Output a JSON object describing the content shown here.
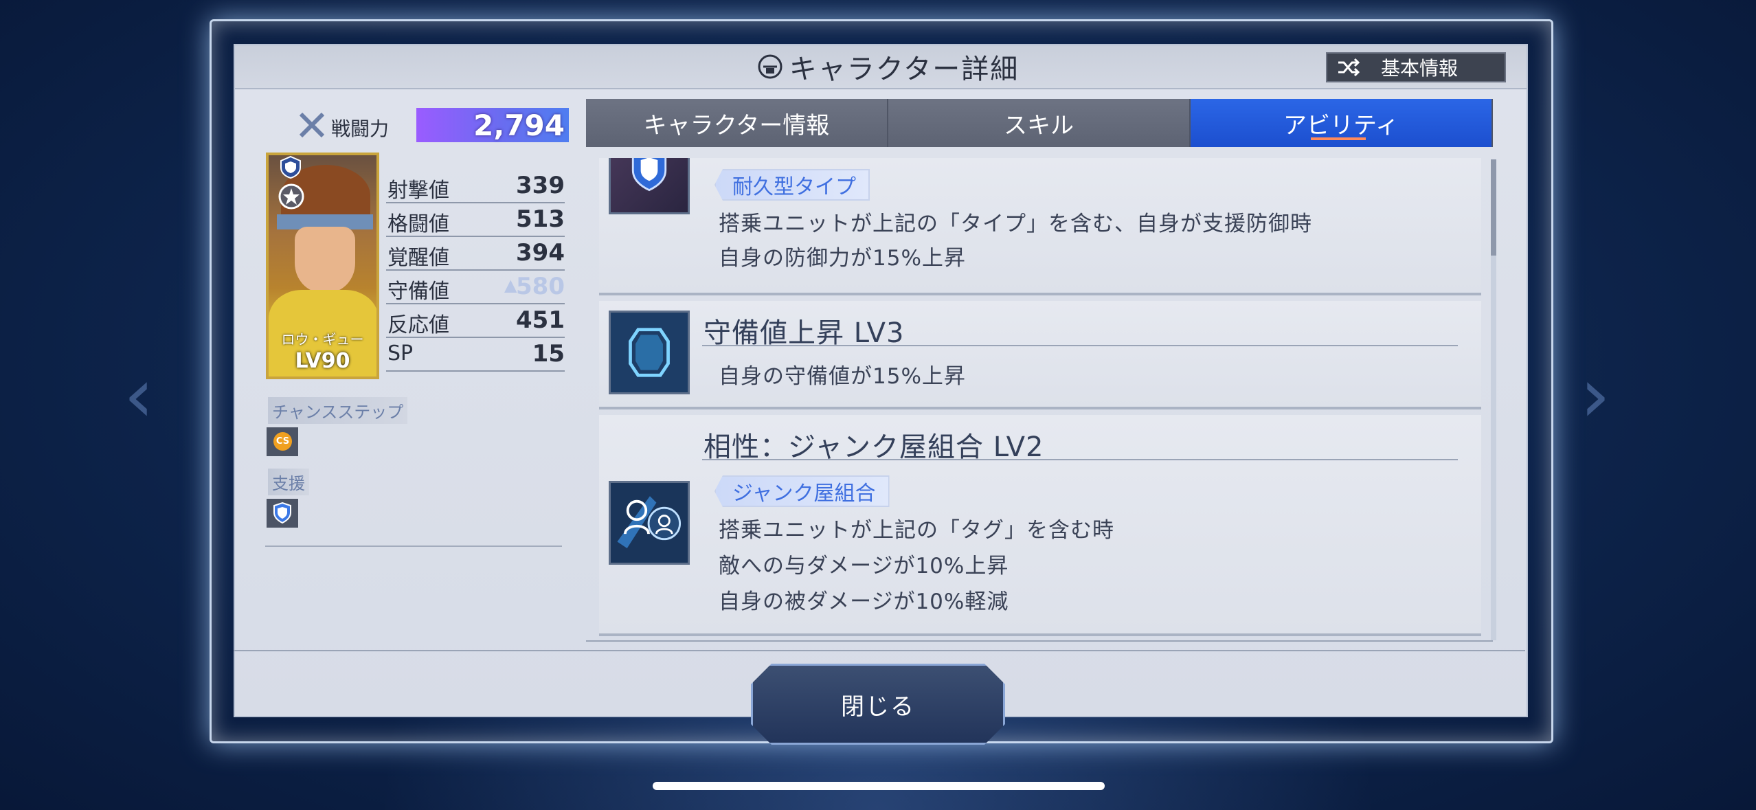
{
  "header": {
    "title": "キャラクター詳細",
    "basic_info_button": "基本情報"
  },
  "left": {
    "power_label": "戦闘力",
    "power_value": "2,794",
    "character": {
      "name": "ロウ・ギュー",
      "level": "LV90"
    },
    "stats": [
      {
        "name": "射撃値",
        "value": "339"
      },
      {
        "name": "格闘値",
        "value": "513"
      },
      {
        "name": "覚醒値",
        "value": "394"
      },
      {
        "name": "守備値",
        "value": "580"
      },
      {
        "name": "反応値",
        "value": "451"
      },
      {
        "name": "SP",
        "value": "15"
      }
    ],
    "chance_step_label": "チャンスステップ",
    "chance_step_icon_text": "CS",
    "support_label": "支援"
  },
  "tabs": [
    {
      "label": "キャラクター情報",
      "active": false
    },
    {
      "label": "スキル",
      "active": false
    },
    {
      "label": "アビリティ",
      "active": true
    }
  ],
  "abilities": [
    {
      "tag": "耐久型タイプ",
      "lines": [
        "搭乗ユニットが上記の「タイプ」を含む、自身が支援防御時",
        "自身の防御力が15%上昇"
      ]
    },
    {
      "title": "守備値上昇 LV3",
      "lines": [
        "自身の守備値が15%上昇"
      ]
    },
    {
      "title": "相性：ジャンク屋組合 LV2",
      "tag": "ジャンク屋組合",
      "lines": [
        "搭乗ユニットが上記の「タグ」を含む時",
        "敵への与ダメージが10%上昇",
        "自身の被ダメージが10%軽減"
      ]
    }
  ],
  "footer": {
    "close_button": "閉じる"
  },
  "colors": {
    "active_tab": "#1c4fcf",
    "tag_text": "#3f6fe0",
    "power_bar": "#7a5cf5"
  }
}
